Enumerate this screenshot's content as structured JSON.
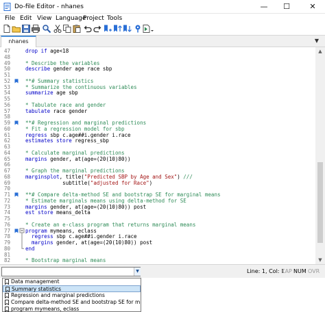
{
  "window": {
    "title": "Do-file Editor - nhanes",
    "minimize": "—",
    "maximize": "☐",
    "close": "✕"
  },
  "menu": [
    "File",
    "Edit",
    "View",
    "Language",
    "Project",
    "Tools"
  ],
  "toolbar": {
    "icons": [
      "new-file-icon",
      "open-folder-icon",
      "save-icon",
      "print-icon",
      "find-icon",
      "cut-icon",
      "copy-icon",
      "paste-icon",
      "undo-icon",
      "redo-icon",
      "toggle-bookmark-icon",
      "previous-bookmark-icon",
      "next-bookmark-icon",
      "show-file-in-viewer-icon",
      "execute-do-icon"
    ]
  },
  "tabs": [
    {
      "label": "nhanes",
      "active": true
    }
  ],
  "editor": {
    "lines": [
      {
        "num": "47",
        "bm": false,
        "parts": [
          {
            "t": "kw",
            "v": "drop if"
          },
          {
            "t": "nm",
            "v": " age<18"
          }
        ]
      },
      {
        "num": "48",
        "bm": false,
        "parts": []
      },
      {
        "num": "49",
        "bm": false,
        "parts": [
          {
            "t": "cm",
            "v": "* Describe the variables"
          }
        ]
      },
      {
        "num": "50",
        "bm": false,
        "parts": [
          {
            "t": "kw",
            "v": "describe"
          },
          {
            "t": "nm",
            "v": " gender age race sbp"
          }
        ]
      },
      {
        "num": "51",
        "bm": false,
        "parts": []
      },
      {
        "num": "52",
        "bm": true,
        "parts": [
          {
            "t": "cm",
            "v": "**# Summary statistics"
          }
        ]
      },
      {
        "num": "53",
        "bm": false,
        "parts": [
          {
            "t": "cm",
            "v": "* Summarize the continuous variables"
          }
        ]
      },
      {
        "num": "54",
        "bm": false,
        "parts": [
          {
            "t": "kw",
            "v": "summarize"
          },
          {
            "t": "nm",
            "v": " age sbp"
          }
        ]
      },
      {
        "num": "55",
        "bm": false,
        "parts": []
      },
      {
        "num": "56",
        "bm": false,
        "parts": [
          {
            "t": "cm",
            "v": "* Tabulate race and gender"
          }
        ]
      },
      {
        "num": "57",
        "bm": false,
        "parts": [
          {
            "t": "kw",
            "v": "tabulate"
          },
          {
            "t": "nm",
            "v": " race gender"
          }
        ]
      },
      {
        "num": "58",
        "bm": false,
        "parts": []
      },
      {
        "num": "59",
        "bm": true,
        "parts": [
          {
            "t": "cm",
            "v": "**# Regression and marginal predictions"
          }
        ]
      },
      {
        "num": "60",
        "bm": false,
        "parts": [
          {
            "t": "cm",
            "v": "* Fit a regression model for sbp"
          }
        ]
      },
      {
        "num": "61",
        "bm": false,
        "parts": [
          {
            "t": "kw",
            "v": "regress"
          },
          {
            "t": "nm",
            "v": " sbp c.age##i.gender i.race"
          }
        ]
      },
      {
        "num": "62",
        "bm": false,
        "parts": [
          {
            "t": "kw",
            "v": "estimates store"
          },
          {
            "t": "nm",
            "v": " regress_sbp"
          }
        ]
      },
      {
        "num": "63",
        "bm": false,
        "parts": []
      },
      {
        "num": "64",
        "bm": false,
        "parts": [
          {
            "t": "cm",
            "v": "* Calculate marginal predictions"
          }
        ]
      },
      {
        "num": "65",
        "bm": false,
        "parts": [
          {
            "t": "kw",
            "v": "margins"
          },
          {
            "t": "nm",
            "v": " gender, at(age=(20(10)80))"
          }
        ]
      },
      {
        "num": "66",
        "bm": false,
        "parts": []
      },
      {
        "num": "67",
        "bm": false,
        "parts": [
          {
            "t": "cm",
            "v": "* Graph the marginal predictions"
          }
        ]
      },
      {
        "num": "68",
        "bm": false,
        "parts": [
          {
            "t": "kw",
            "v": "marginsplot"
          },
          {
            "t": "nm",
            "v": ", title("
          },
          {
            "t": "st",
            "v": "\"Predicted SBP by Age and Sex\""
          },
          {
            "t": "nm",
            "v": ") "
          },
          {
            "t": "cm",
            "v": "///"
          }
        ]
      },
      {
        "num": "69",
        "bm": false,
        "parts": [
          {
            "t": "nm",
            "v": "            subtitle("
          },
          {
            "t": "st",
            "v": "\"adjusted for Race\""
          },
          {
            "t": "nm",
            "v": ")"
          }
        ]
      },
      {
        "num": "70",
        "bm": false,
        "parts": []
      },
      {
        "num": "71",
        "bm": true,
        "parts": [
          {
            "t": "cm",
            "v": "**# Compare delta-method SE and bootstrap SE for marginal means"
          }
        ]
      },
      {
        "num": "72",
        "bm": false,
        "parts": [
          {
            "t": "cm",
            "v": "* Estimate marginals means using delta-method for SE"
          }
        ]
      },
      {
        "num": "73",
        "bm": false,
        "parts": [
          {
            "t": "kw",
            "v": "margins"
          },
          {
            "t": "nm",
            "v": " gender, at(age=(20(10)80)) post"
          }
        ]
      },
      {
        "num": "74",
        "bm": false,
        "parts": [
          {
            "t": "kw",
            "v": "est store"
          },
          {
            "t": "nm",
            "v": " means_delta"
          }
        ]
      },
      {
        "num": "75",
        "bm": false,
        "parts": []
      },
      {
        "num": "76",
        "bm": false,
        "parts": [
          {
            "t": "cm",
            "v": "* Create an e-class program that returns marginal means"
          }
        ]
      },
      {
        "num": "77",
        "bm": true,
        "parts": [
          {
            "t": "kw",
            "v": "program"
          },
          {
            "t": "nm",
            "v": " mymeans, eclass"
          }
        ]
      },
      {
        "num": "78",
        "bm": false,
        "parts": [
          {
            "t": "nm",
            "v": "  "
          },
          {
            "t": "kw",
            "v": "regress"
          },
          {
            "t": "nm",
            "v": " sbp c.age##i.gender i.race"
          }
        ]
      },
      {
        "num": "79",
        "bm": false,
        "parts": [
          {
            "t": "nm",
            "v": "  "
          },
          {
            "t": "kw",
            "v": "margins"
          },
          {
            "t": "nm",
            "v": " gender, at(age=(20(10)80)) post"
          }
        ]
      },
      {
        "num": "80",
        "bm": false,
        "parts": [
          {
            "t": "kw",
            "v": "end"
          }
        ]
      },
      {
        "num": "81",
        "bm": false,
        "parts": []
      },
      {
        "num": "82",
        "bm": false,
        "parts": [
          {
            "t": "cm",
            "v": "* Bootstrap marginal means"
          }
        ]
      }
    ]
  },
  "status": {
    "position": "Line: 1, Col: 1",
    "flags": [
      {
        "label": "CAP",
        "on": false
      },
      {
        "label": "NUM",
        "on": true
      },
      {
        "label": "OVR",
        "on": false
      }
    ]
  },
  "navigator": {
    "items": [
      {
        "label": "Data management",
        "selected": false
      },
      {
        "label": "Summary statistics",
        "selected": true
      },
      {
        "label": "Regression and marginal predictions",
        "selected": false
      },
      {
        "label": "Compare delta-method SE and bootstrap SE for marginal m",
        "selected": false
      },
      {
        "label": "program mymeans, eclass",
        "selected": false
      }
    ]
  },
  "colors": {
    "keyword": "#0000c8",
    "comment": "#2e8b57",
    "string": "#a31515",
    "bookmark": "#2a6fd6",
    "tab_accent": "#4a90d9"
  }
}
